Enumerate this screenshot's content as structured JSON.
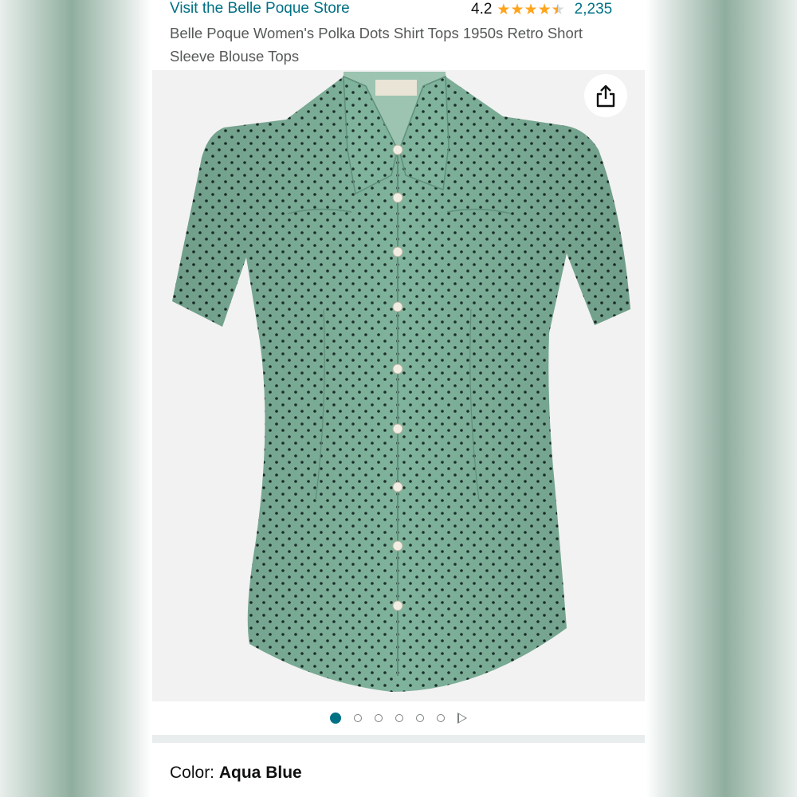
{
  "header": {
    "store_link": "Visit the Belle Poque Store",
    "rating_value": "4.2",
    "rating": 4.2,
    "rating_max": 5,
    "review_count": "2,235",
    "title": "Belle Poque Women's Polka Dots Shirt Tops 1950s Retro Short Sleeve Blouse Tops"
  },
  "gallery": {
    "image_count": 6,
    "active_index": 0,
    "share_icon": "share-icon",
    "play_icon": "play-icon"
  },
  "variation": {
    "label": "Color: ",
    "value": "Aqua Blue"
  },
  "colors": {
    "link": "#007185",
    "star": "#FFA41C",
    "shirt": "#7fb39c",
    "dot_pattern": "#1b2e28"
  }
}
